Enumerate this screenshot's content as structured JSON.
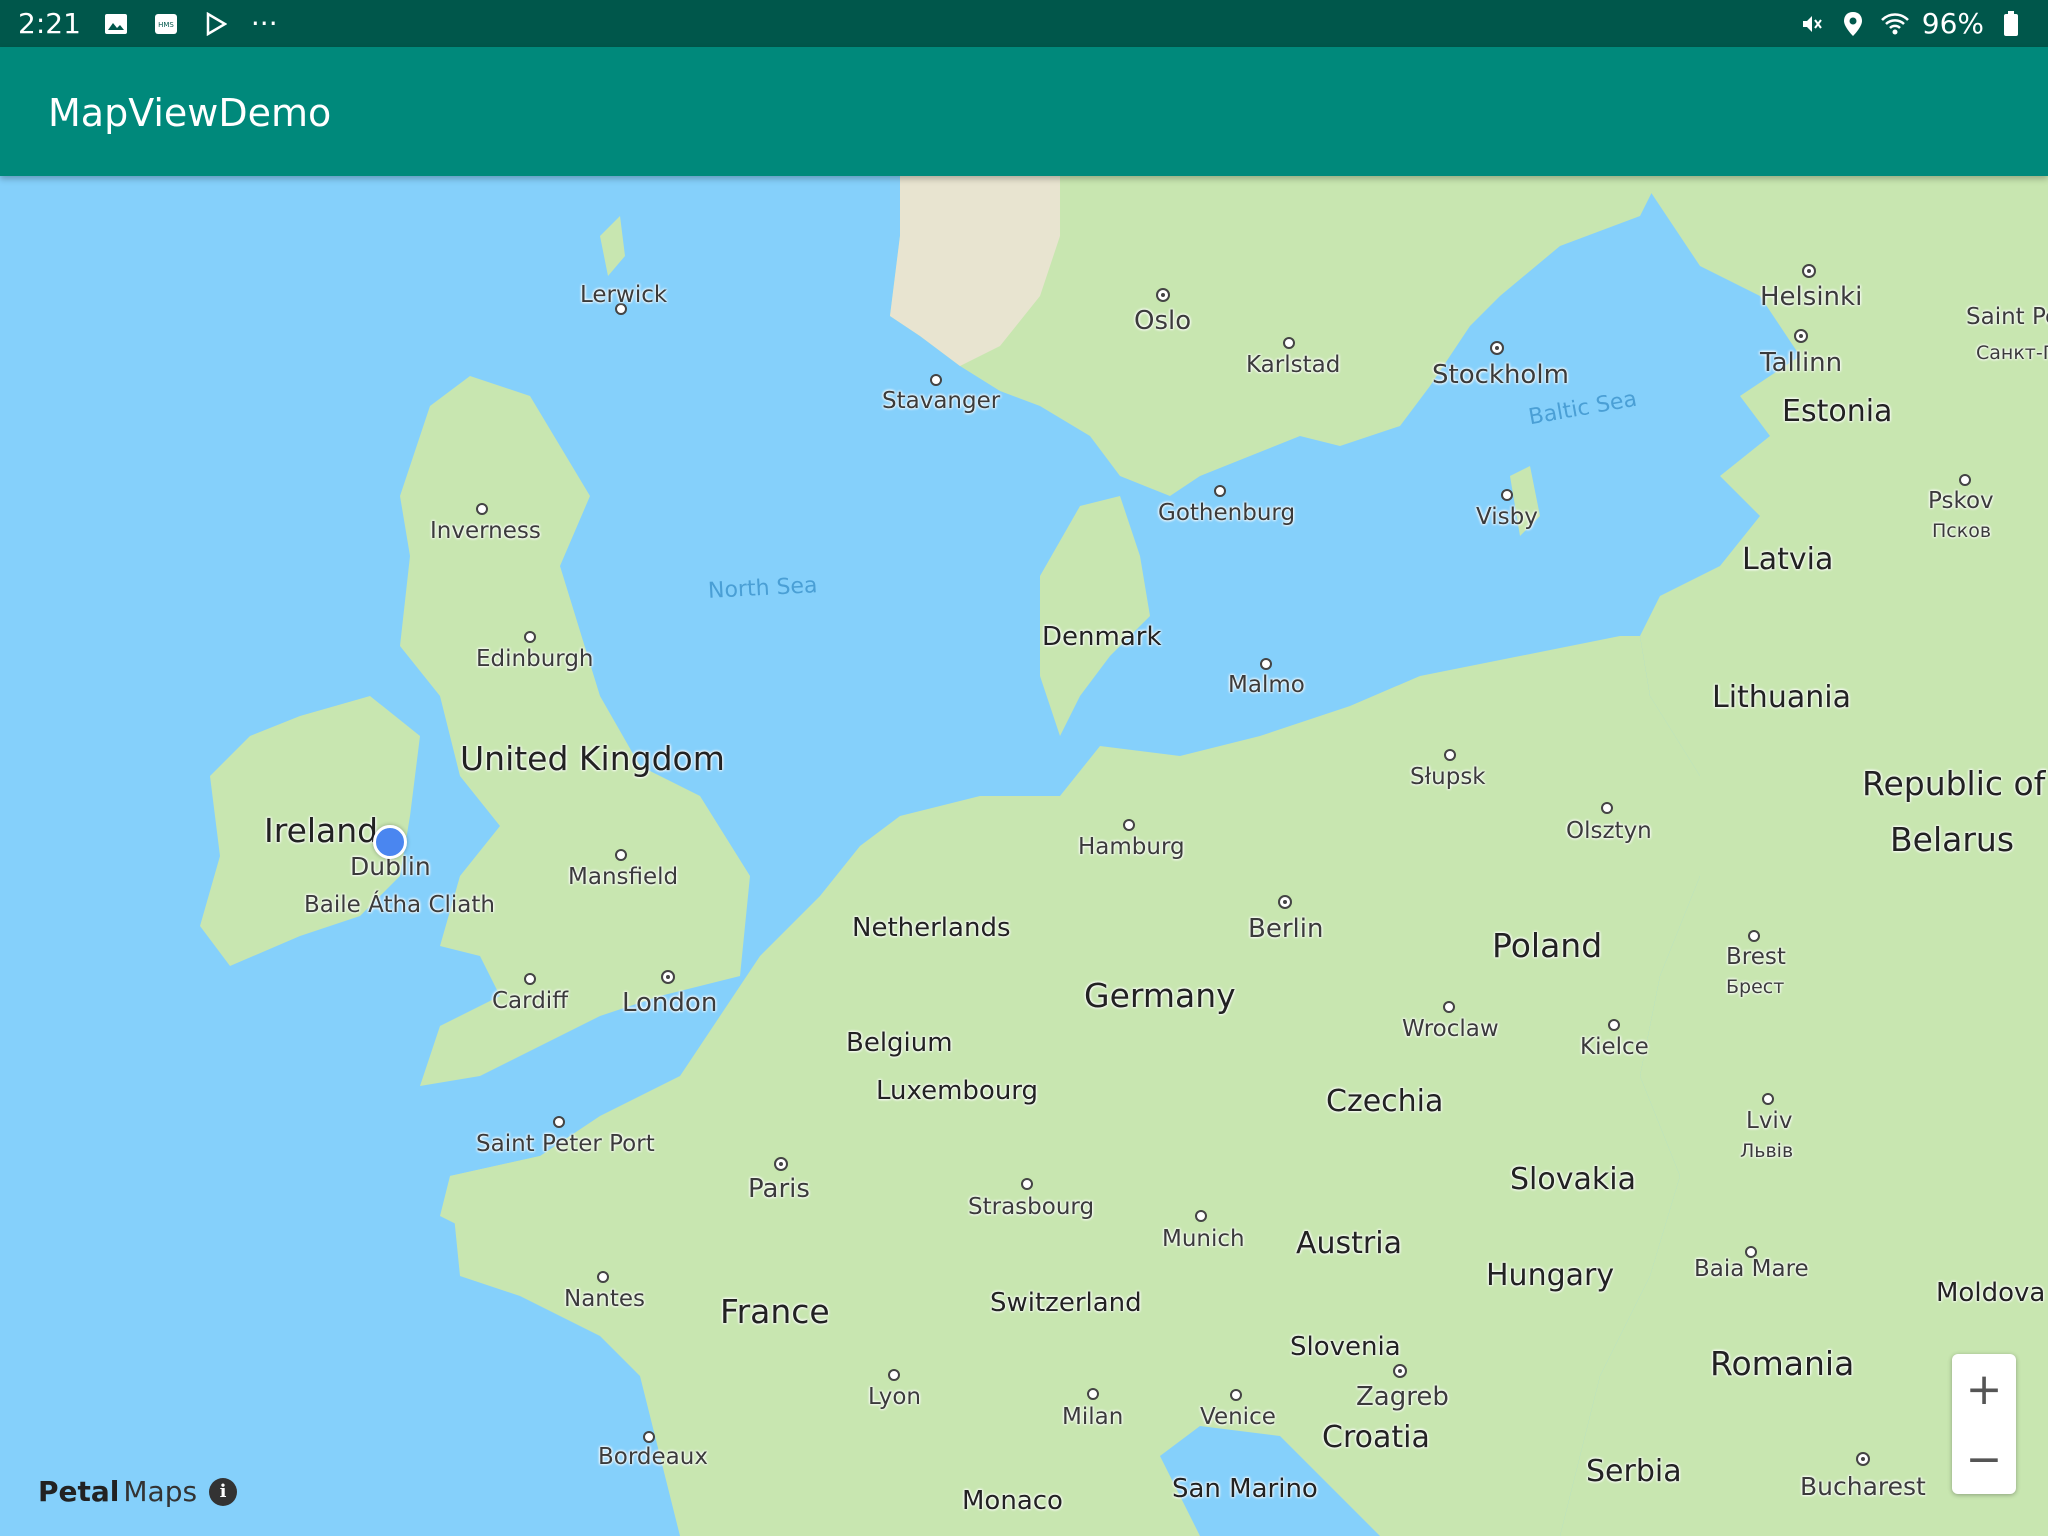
{
  "status_bar": {
    "time": "2:21",
    "more": "···",
    "battery": "96%",
    "icons": [
      "gallery-icon",
      "hms-icon",
      "play-store-icon",
      "mute-icon",
      "location-icon",
      "wifi-icon",
      "battery-icon"
    ]
  },
  "app_bar": {
    "title": "MapViewDemo"
  },
  "map": {
    "seas": {
      "north_sea": "North Sea",
      "baltic_sea": "Baltic Sea"
    },
    "countries": {
      "united_kingdom": "United Kingdom",
      "ireland": "Ireland",
      "netherlands": "Netherlands",
      "belgium": "Belgium",
      "luxembourg": "Luxembourg",
      "germany": "Germany",
      "france": "France",
      "switzerland": "Switzerland",
      "austria": "Austria",
      "czechia": "Czechia",
      "poland": "Poland",
      "slovakia": "Slovakia",
      "hungary": "Hungary",
      "slovenia": "Slovenia",
      "croatia": "Croatia",
      "serbia": "Serbia",
      "romania": "Romania",
      "denmark": "Denmark",
      "lithuania": "Lithuania",
      "latvia": "Latvia",
      "estonia": "Estonia",
      "belarus_1": "Republic of",
      "belarus_2": "Belarus",
      "moldova": "Moldova",
      "san_marino": "San Marino",
      "monaco": "Monaco"
    },
    "cities": {
      "lerwick": "Lerwick",
      "inverness": "Inverness",
      "edinburgh": "Edinburgh",
      "dublin": "Dublin",
      "baile_atha_cliath": "Baile Átha Cliath",
      "mansfield": "Mansfield",
      "cardiff": "Cardiff",
      "london": "London",
      "saint_peter_port": "Saint Peter Port",
      "paris": "Paris",
      "nantes": "Nantes",
      "bordeaux": "Bordeaux",
      "lyon": "Lyon",
      "strasbourg": "Strasbourg",
      "munich": "Munich",
      "milan": "Milan",
      "venice": "Venice",
      "zagreb": "Zagreb",
      "hamburg": "Hamburg",
      "berlin": "Berlin",
      "wroclaw": "Wroclaw",
      "kielce": "Kielce",
      "slupsk": "Słupsk",
      "olsztyn": "Olsztyn",
      "brest": "Brest",
      "brest_cyr": "Брест",
      "lviv": "Lviv",
      "lviv_cyr": "Львів",
      "baia_mare": "Baia Mare",
      "bucharest": "Bucharest",
      "oslo": "Oslo",
      "stavanger": "Stavanger",
      "karlstad": "Karlstad",
      "stockholm": "Stockholm",
      "gothenburg": "Gothenburg",
      "malmo": "Malmo",
      "visby": "Visby",
      "helsinki": "Helsinki",
      "tallinn": "Tallinn",
      "saint_pe": "Saint Pe",
      "sankt_p": "Санкт-П",
      "pskov": "Pskov",
      "pskov_cyr": "Псков"
    },
    "controls": {
      "zoom_in": "+",
      "zoom_out": "−"
    }
  },
  "branding": {
    "petal": "Petal",
    "maps": "Maps",
    "info": "i"
  },
  "colors": {
    "status_bar": "#00574b",
    "app_bar": "#00897b",
    "water": "#85d0fb",
    "land": "#c8e6b0",
    "location": "#4a86f0"
  }
}
